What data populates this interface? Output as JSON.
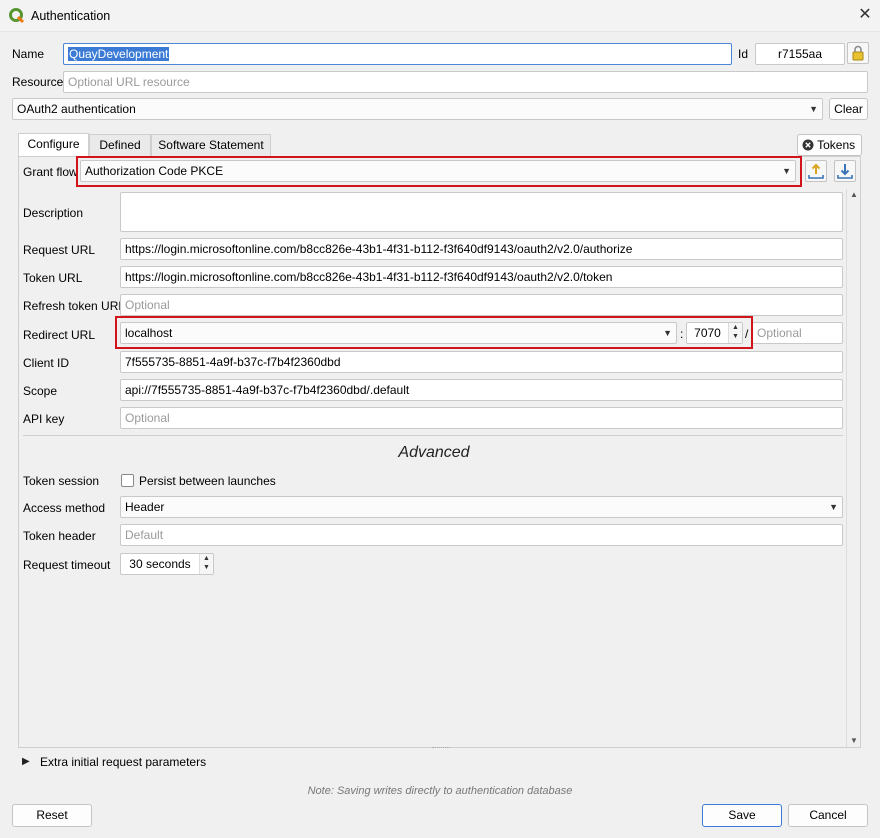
{
  "window": {
    "title": "Authentication",
    "close_glyph": "✕"
  },
  "header": {
    "name_label": "Name",
    "name_value": "QuayDevelopment",
    "id_label": "Id",
    "id_value": "r7155aa",
    "resource_label": "Resource",
    "resource_placeholder": "Optional URL resource",
    "method_value": "OAuth2 authentication",
    "clear_label": "Clear"
  },
  "tabs": [
    {
      "label": "Configure",
      "active": true
    },
    {
      "label": "Defined",
      "active": false
    },
    {
      "label": "Software Statement",
      "active": false
    }
  ],
  "tokens_button": {
    "label": "Tokens",
    "icon": "close-circle-icon"
  },
  "configure": {
    "grant_flow_label": "Grant flow",
    "grant_flow_value": "Authorization Code PKCE",
    "description_label": "Description",
    "description_value": "",
    "request_url_label": "Request URL",
    "request_url_value": "https://login.microsoftonline.com/b8cc826e-43b1-4f31-b112-f3f640df9143/oauth2/v2.0/authorize",
    "token_url_label": "Token URL",
    "token_url_value": "https://login.microsoftonline.com/b8cc826e-43b1-4f31-b112-f3f640df9143/oauth2/v2.0/token",
    "refresh_token_url_label": "Refresh token URL",
    "refresh_token_url_placeholder": "Optional",
    "redirect_url_label": "Redirect URL",
    "redirect_host_value": "localhost",
    "redirect_colon": ":",
    "redirect_port_value": "7070",
    "redirect_slash": "/",
    "redirect_path_placeholder": "Optional",
    "client_id_label": "Client ID",
    "client_id_value": "7f555735-8851-4a9f-b37c-f7b4f2360dbd",
    "scope_label": "Scope",
    "scope_value": "api://7f555735-8851-4a9f-b37c-f7b4f2360dbd/.default",
    "api_key_label": "API key",
    "api_key_placeholder": "Optional"
  },
  "advanced": {
    "heading": "Advanced",
    "token_session_label": "Token session",
    "persist_label": "Persist between launches",
    "persist_checked": false,
    "access_method_label": "Access method",
    "access_method_value": "Header",
    "token_header_label": "Token header",
    "token_header_placeholder": "Default",
    "request_timeout_label": "Request timeout",
    "request_timeout_value": "30 seconds"
  },
  "extra_params_label": "Extra initial request parameters",
  "note": "Note: Saving writes directly to authentication database",
  "footer": {
    "reset_label": "Reset",
    "save_label": "Save",
    "cancel_label": "Cancel"
  },
  "colors": {
    "highlight_box": "#d1131c",
    "selection": "#3b7bd6",
    "qgis_green": "#589632"
  }
}
